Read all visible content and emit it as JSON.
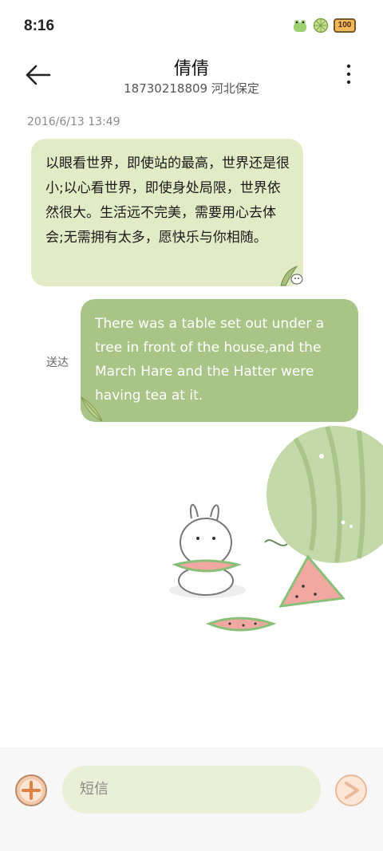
{
  "status_bar": {
    "time": "8:16",
    "battery": "100",
    "icons": [
      "frog-icon",
      "lime-icon",
      "battery-icon"
    ]
  },
  "header": {
    "contact_name": "倩倩",
    "contact_detail": "18730218809 河北保定",
    "back_icon": "arrow-left-icon",
    "more_icon": "more-vertical-icon"
  },
  "conversation": {
    "timestamp": "2016/6/13 13:49",
    "messages": [
      {
        "direction": "incoming",
        "text": "以眼看世界，即使站的最高，世界还是很小;以心看世界，即使身处局限，世界依然很大。生活远不完美，需要用心去体会;无需拥有太多，愿快乐与你相随。"
      },
      {
        "direction": "outgoing",
        "text": "There was a table set out under a tree in front of the house,and the March Hare and the Hatter were having tea at it.",
        "status": "送达"
      }
    ]
  },
  "composer": {
    "placeholder": "短信",
    "add_icon": "plus-circle-icon",
    "send_icon": "send-icon"
  },
  "colors": {
    "incoming_bubble": "#e2ebc6",
    "outgoing_bubble": "#a9c487",
    "composer_background": "#eaf0d6",
    "accent": "#e0813f"
  }
}
